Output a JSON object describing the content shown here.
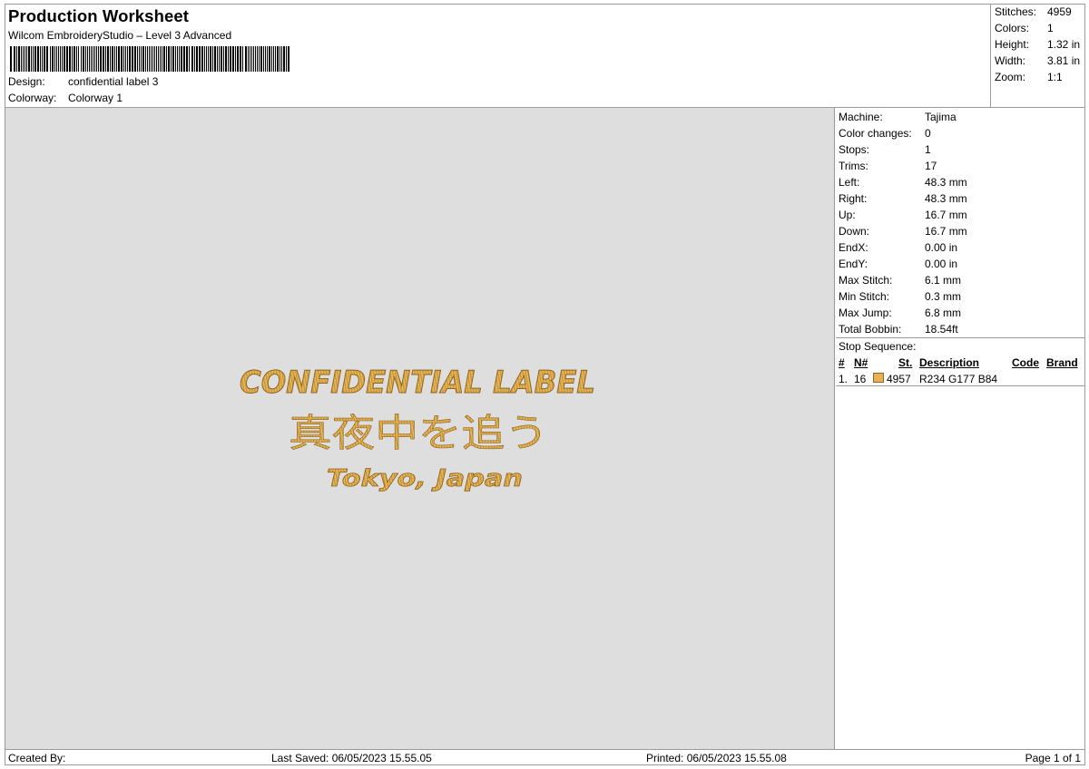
{
  "header": {
    "title": "Production Worksheet",
    "software": "Wilcom EmbroideryStudio – Level 3 Advanced",
    "design_label": "Design:",
    "design_value": "confidential label 3",
    "colorway_label": "Colorway:",
    "colorway_value": "Colorway 1"
  },
  "summary": [
    {
      "label": "Stitches:",
      "value": "4959"
    },
    {
      "label": "Colors:",
      "value": "1"
    },
    {
      "label": "Height:",
      "value": "1.32 in"
    },
    {
      "label": "Width:",
      "value": "3.81 in"
    },
    {
      "label": "Zoom:",
      "value": "1:1"
    }
  ],
  "machine_info": [
    {
      "label": "Machine:",
      "value": "Tajima"
    },
    {
      "label": "Color changes:",
      "value": "0"
    },
    {
      "label": "Stops:",
      "value": "1"
    },
    {
      "label": "Trims:",
      "value": "17"
    },
    {
      "label": "Left:",
      "value": "48.3 mm"
    },
    {
      "label": "Right:",
      "value": "48.3 mm"
    },
    {
      "label": "Up:",
      "value": "16.7 mm"
    },
    {
      "label": "Down:",
      "value": "16.7 mm"
    },
    {
      "label": "EndX:",
      "value": "0.00 in"
    },
    {
      "label": "EndY:",
      "value": "0.00 in"
    },
    {
      "label": "Max Stitch:",
      "value": "6.1 mm"
    },
    {
      "label": "Min Stitch:",
      "value": "0.3 mm"
    },
    {
      "label": "Max Jump:",
      "value": "6.8 mm"
    },
    {
      "label": "Total Bobbin:",
      "value": "18.54ft"
    }
  ],
  "stop_sequence": {
    "caption": "Stop Sequence:",
    "columns": {
      "index": "#",
      "needle": "N#",
      "stitches": "St.",
      "description": "Description",
      "code": "Code",
      "brand": "Brand"
    },
    "rows": [
      {
        "index": "1.",
        "needle": "16",
        "swatch_color": "#EAB154",
        "stitches": "4957",
        "description": "R234 G177 B84",
        "code": "",
        "brand": ""
      }
    ]
  },
  "design": {
    "line1": "CONFIDENTIAL LABEL",
    "line2": "真夜中を追う",
    "line3": "Tokyo, Japan",
    "thread_color": "#EAB154",
    "background_color": "#DEDEDE"
  },
  "footer": {
    "created_by": "Created By:",
    "last_saved": "Last Saved: 06/05/2023 15.55.05",
    "printed": "Printed: 06/05/2023 15.55.08",
    "page": "Page 1 of 1"
  }
}
